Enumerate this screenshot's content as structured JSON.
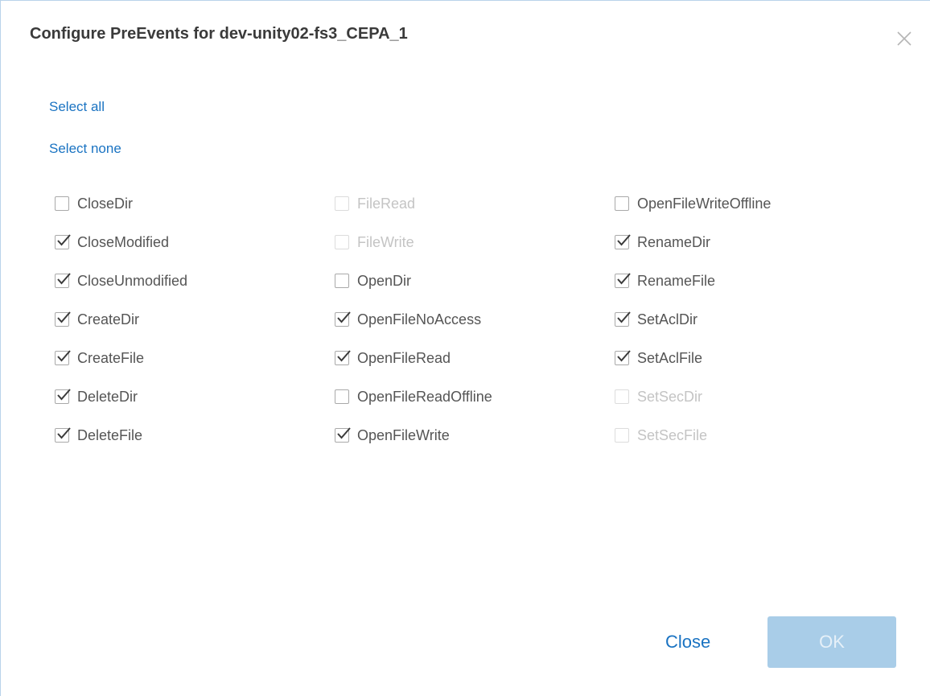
{
  "dialog": {
    "title": "Configure PreEvents for dev-unity02-fs3_CEPA_1",
    "close_icon": "close-x-icon"
  },
  "links": {
    "select_all": "Select all",
    "select_none": "Select none"
  },
  "events": [
    [
      {
        "label": "CloseDir",
        "checked": false,
        "disabled": false
      },
      {
        "label": "FileRead",
        "checked": false,
        "disabled": true
      },
      {
        "label": "OpenFileWriteOffline",
        "checked": false,
        "disabled": false
      }
    ],
    [
      {
        "label": "CloseModified",
        "checked": true,
        "disabled": false
      },
      {
        "label": "FileWrite",
        "checked": false,
        "disabled": true
      },
      {
        "label": "RenameDir",
        "checked": true,
        "disabled": false
      }
    ],
    [
      {
        "label": "CloseUnmodified",
        "checked": true,
        "disabled": false
      },
      {
        "label": "OpenDir",
        "checked": false,
        "disabled": false
      },
      {
        "label": "RenameFile",
        "checked": true,
        "disabled": false
      }
    ],
    [
      {
        "label": "CreateDir",
        "checked": true,
        "disabled": false
      },
      {
        "label": "OpenFileNoAccess",
        "checked": true,
        "disabled": false
      },
      {
        "label": "SetAclDir",
        "checked": true,
        "disabled": false
      }
    ],
    [
      {
        "label": "CreateFile",
        "checked": true,
        "disabled": false
      },
      {
        "label": "OpenFileRead",
        "checked": true,
        "disabled": false
      },
      {
        "label": "SetAclFile",
        "checked": true,
        "disabled": false
      }
    ],
    [
      {
        "label": "DeleteDir",
        "checked": true,
        "disabled": false
      },
      {
        "label": "OpenFileReadOffline",
        "checked": false,
        "disabled": false
      },
      {
        "label": "SetSecDir",
        "checked": false,
        "disabled": true
      }
    ],
    [
      {
        "label": "DeleteFile",
        "checked": true,
        "disabled": false
      },
      {
        "label": "OpenFileWrite",
        "checked": true,
        "disabled": false
      },
      {
        "label": "SetSecFile",
        "checked": false,
        "disabled": true
      }
    ]
  ],
  "footer": {
    "close_label": "Close",
    "ok_label": "OK",
    "ok_disabled": true
  },
  "colors": {
    "link": "#1a73c2",
    "ok_button_bg": "#a9cde8",
    "label_text": "#555555",
    "disabled_text": "#c4c4c4"
  }
}
